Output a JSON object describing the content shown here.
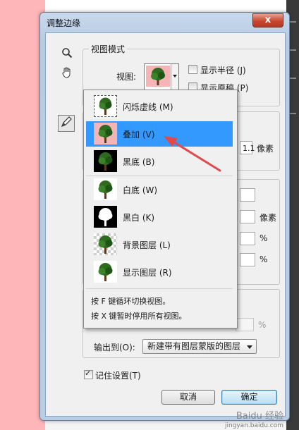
{
  "dialog": {
    "title": "调整边缘",
    "close_label": "x"
  },
  "tools": {
    "zoom_icon": "magnifier-icon",
    "hand_icon": "hand-icon",
    "brush_icon": "refine-radius-brush-icon"
  },
  "view_mode": {
    "group_title": "视图模式",
    "view_label": "视图:",
    "show_radius_label": "显示半径 (J)",
    "show_original_label": "显示原稿 (P)",
    "show_radius_checked": false,
    "show_original_checked": false
  },
  "edge_detection": {
    "radius_value": "1.1",
    "radius_unit": "像素"
  },
  "adjust_edge": {
    "feather_unit": "像素",
    "contrast_unit": "%",
    "shift_unit": "%"
  },
  "output": {
    "amount_unit": "%",
    "output_to_label": "输出到(O):",
    "output_to_value": "新建带有图层蒙版的图层",
    "remember_label": "记住设置(T)",
    "remember_checked": true
  },
  "buttons": {
    "cancel": "取消",
    "ok": "确定"
  },
  "view_menu": {
    "items": [
      {
        "label": "闪烁虚线 (M)",
        "thumb": "marching-ants",
        "selected": false
      },
      {
        "label": "叠加 (V)",
        "thumb": "overlay",
        "selected": true
      },
      {
        "label": "黑底 (B)",
        "thumb": "on-black",
        "selected": false
      },
      {
        "label": "白底 (W)",
        "thumb": "on-white",
        "selected": false
      },
      {
        "label": "黑白 (K)",
        "thumb": "black-white",
        "selected": false
      },
      {
        "label": "背景图层 (L)",
        "thumb": "on-layers",
        "selected": false
      },
      {
        "label": "显示图层 (R)",
        "thumb": "reveal-layer",
        "selected": false
      }
    ],
    "hint_1": "按 F 键循环切换视图。",
    "hint_2": "按 X 键暂时停用所有视图。"
  },
  "watermark": {
    "text": "Baidu 经验",
    "url": "jingyan.baidu.com"
  },
  "colors": {
    "pink": "#ffb6b9",
    "selected": "#3399ff",
    "arrow": "#e04a4a"
  }
}
